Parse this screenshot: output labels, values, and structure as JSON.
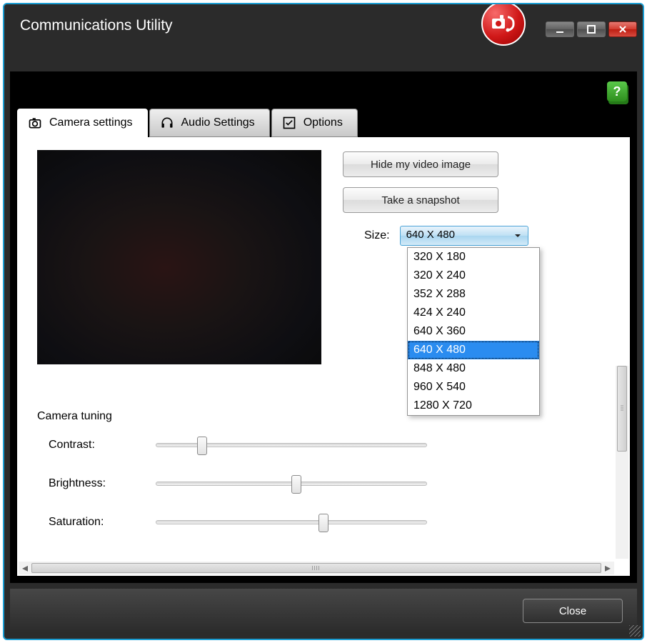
{
  "window": {
    "title": "Communications Utility",
    "close_label": "Close"
  },
  "tabs": [
    {
      "label": "Camera settings"
    },
    {
      "label": "Audio Settings"
    },
    {
      "label": "Options"
    }
  ],
  "buttons": {
    "hide_video": "Hide my video image",
    "snapshot": "Take a snapshot"
  },
  "size": {
    "label": "Size:",
    "selected": "640 X 480",
    "options": [
      "320 X 180",
      "320 X 240",
      "352 X 288",
      "424 X 240",
      "640 X 360",
      "640 X 480",
      "848 X 480",
      "960 X 540",
      "1280 X 720"
    ]
  },
  "tuning": {
    "heading": "Camera tuning",
    "sliders": {
      "contrast": {
        "label": "Contrast:",
        "value": 15
      },
      "brightness": {
        "label": "Brightness:",
        "value": 50
      },
      "saturation": {
        "label": "Saturation:",
        "value": 60
      }
    }
  }
}
